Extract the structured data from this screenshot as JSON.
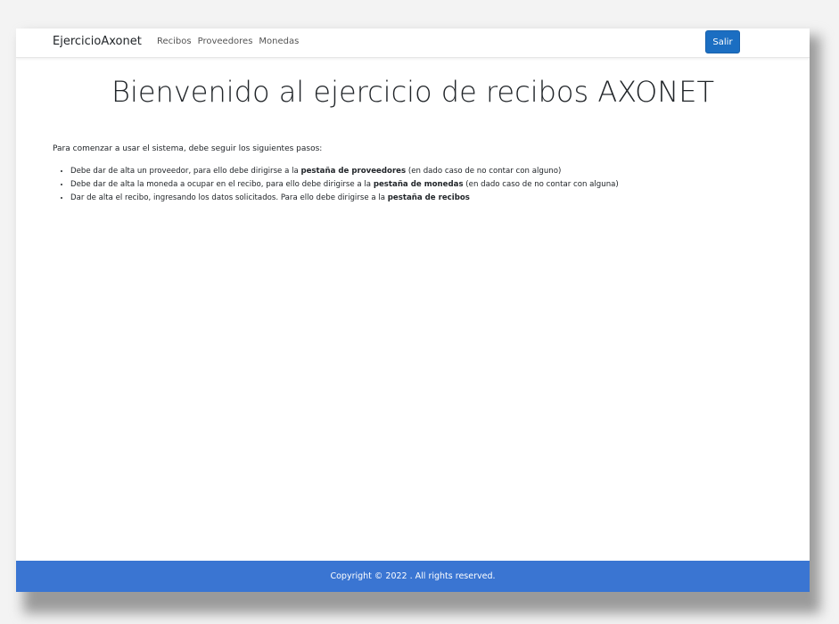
{
  "navbar": {
    "brand": "EjercicioAxonet",
    "links": [
      "Recibos",
      "Proveedores",
      "Monedas"
    ],
    "logout_label": "Salir"
  },
  "main": {
    "title": "Bienvenido al ejercicio de recibos AXONET",
    "intro": "Para comenzar a usar el sistema, debe seguir los siguientes pasos:",
    "steps": [
      {
        "before": "Debe dar de alta un proveedor, para ello debe dirigirse a la ",
        "bold": "pestaña de proveedores",
        "after": " (en dado caso de no contar con alguno)"
      },
      {
        "before": "Debe dar de alta la moneda a ocupar en el recibo, para ello debe dirigirse a la ",
        "bold": "pestaña de monedas",
        "after": " (en dado caso de no contar con alguna)"
      },
      {
        "before": "Dar de alta el recibo, ingresando los datos solicitados. Para ello debe dirigirse a la ",
        "bold": "pestaña de recibos",
        "after": ""
      }
    ]
  },
  "footer": {
    "text": "Copyright © 2022 . All rights reserved."
  },
  "colors": {
    "primary_button": "#1b6ec2",
    "footer_bg": "#3a75d2"
  }
}
